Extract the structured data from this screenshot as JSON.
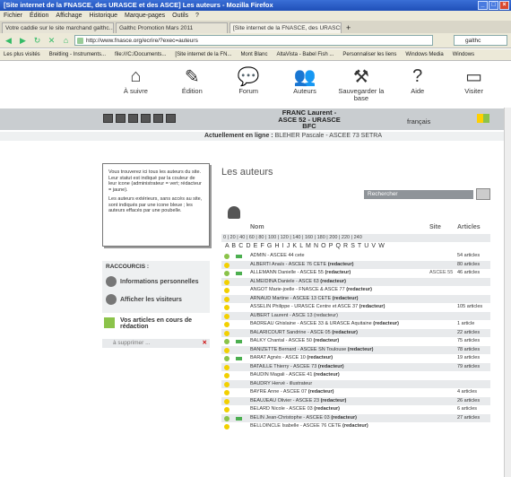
{
  "window": {
    "title": "[Site internet de la FNASCE, des URASCE et des ASCE] Les auteurs - Mozilla Firefox"
  },
  "menu": [
    "Fichier",
    "Édition",
    "Affichage",
    "Historique",
    "Marque-pages",
    "Outils",
    "?"
  ],
  "tabs": [
    {
      "label": "Votre caddie sur le site marchand galthc..."
    },
    {
      "label": "Galthc Promotion Mars 2011"
    },
    {
      "label": "[Site internet de la FNASCE, des URASCE..."
    }
  ],
  "nav": {
    "url": "http://www.fnasce.org/ecrire/?exec=auteurs",
    "search": "galthc"
  },
  "bookmarks": [
    "Les plus visités",
    "Breitling - Instruments...",
    "file:///C:/Documents...",
    "[Site internet de la FN...",
    "Mont Blanc",
    "AltaVista - Babel Fish ...",
    "Personnaliser les liens",
    "Windows Media",
    "Windows"
  ],
  "site_nav": [
    {
      "icon": "house-icon",
      "glyph": "⌂",
      "label": "À suivre"
    },
    {
      "icon": "pencil-icon",
      "glyph": "✎",
      "label": "Édition"
    },
    {
      "icon": "speech-bubble-icon",
      "glyph": "💬",
      "label": "Forum"
    },
    {
      "icon": "people-icon",
      "glyph": "👥",
      "label": "Auteurs"
    },
    {
      "icon": "tools-icon",
      "glyph": "⚒",
      "label": "Sauvegarder la base"
    },
    {
      "icon": "question-icon",
      "glyph": "?",
      "label": "Aide"
    },
    {
      "icon": "monitor-icon",
      "glyph": "▭",
      "label": "Visiter"
    }
  ],
  "banner": {
    "user": "FRANC Laurent - ASCE 52 - URASCE BFC",
    "language": "français"
  },
  "online": {
    "label": "Actuellement en ligne :",
    "names": "BLEHER Pascale - ASCEE 73 SETRA"
  },
  "info_box": {
    "p1": "Vous trouverez ici tous les auteurs du site. Leur statut est indiqué par la couleur de leur icone (administrateur = vert; rédacteur = jaune).",
    "p2": "Les auteurs extérieurs, sans accès au site, sont indiqués par une icone bleue ; les auteurs effacés par une poubelle."
  },
  "shortcuts": {
    "title": "RACCOURCIS :",
    "items": [
      "Informations personnelles",
      "Afficher les visiteurs"
    ]
  },
  "articles": {
    "title": "Vos articles en cours de rédaction",
    "item": "à supprimer ...",
    "delete_glyph": "✕"
  },
  "main": {
    "heading": "Les auteurs",
    "search_placeholder": "Rechercher",
    "columns": {
      "name": "Nom",
      "site": "Site",
      "articles": "Articles"
    },
    "pager": "0 | 20 | 40 | 60 | 80 | 100 | 120 | 140 | 160 | 180 | 200 | 220 | 240",
    "alphabet": "A B C D E F G H I J K L M N O P Q R S T U V W"
  },
  "authors": [
    {
      "role": "admin",
      "mail": true,
      "name": "ADMIN - ASCEE 44 cete",
      "tag": "",
      "site": "",
      "count": "54 articles"
    },
    {
      "role": "red",
      "mail": false,
      "name": "ALBERTI Anaïs - ASCEE 76 CETE",
      "tag": "(redacteur)",
      "site": "",
      "count": "80 articles"
    },
    {
      "role": "admin",
      "mail": true,
      "name": "ALLEMANN Danielle - ASCEE 55",
      "tag": "(redacteur)",
      "site": "ASCEE 55",
      "count": "46 articles"
    },
    {
      "role": "red",
      "mail": false,
      "name": "ALMEIDINA Daniele - ASCE 63",
      "tag": "(redacteur)",
      "site": "",
      "count": ""
    },
    {
      "role": "red",
      "mail": false,
      "name": "ANGOT Marie-joelle - FNASCE & ASCE 77",
      "tag": "(redacteur)",
      "site": "",
      "count": ""
    },
    {
      "role": "red",
      "mail": false,
      "name": "ARNAUD Martine - ASCEE 13 CETE",
      "tag": "(redacteur)",
      "site": "",
      "count": ""
    },
    {
      "role": "red",
      "mail": false,
      "name": "ASSELIN Philippe - URASCE Centre et ASCE 37",
      "tag": "(redacteur)",
      "site": "",
      "count": "105 articles"
    },
    {
      "role": "red",
      "mail": false,
      "name": "AUBERT Laurent - ASCE 13 (redacteur)",
      "tag": "",
      "site": "",
      "count": ""
    },
    {
      "role": "red",
      "mail": false,
      "name": "BADREAU Ghislaine - ASCEE 33 & URASCE Aquitaine",
      "tag": "(redacteur)",
      "site": "",
      "count": "1 article"
    },
    {
      "role": "red",
      "mail": false,
      "name": "BALARICOURT Sandrine - ASCE 05",
      "tag": "(redacteur)",
      "site": "",
      "count": "22 articles"
    },
    {
      "role": "admin",
      "mail": true,
      "name": "BALKY Chantal - ASCEE 50",
      "tag": "(redacteur)",
      "site": "",
      "count": "75 articles"
    },
    {
      "role": "red",
      "mail": false,
      "name": "BANIZETTE Bernard - ASCEE SN Toulouse",
      "tag": "(redacteur)",
      "site": "",
      "count": "78 articles"
    },
    {
      "role": "admin",
      "mail": true,
      "name": "BARAT Agnès - ASCE 10",
      "tag": "(redacteur)",
      "site": "",
      "count": "19 articles"
    },
    {
      "role": "red",
      "mail": false,
      "name": "BATAILLE Thierry - ASCEE 73",
      "tag": "(redacteur)",
      "site": "",
      "count": "79 articles"
    },
    {
      "role": "red",
      "mail": false,
      "name": "BAUDIN Magali - ASCEE 41",
      "tag": "(redacteur)",
      "site": "",
      "count": ""
    },
    {
      "role": "red",
      "mail": false,
      "name": "BAUDRY Hervé - illustrateur",
      "tag": "",
      "site": "",
      "count": ""
    },
    {
      "role": "red",
      "mail": false,
      "name": "BAYRE Anne - ASCEE 07",
      "tag": "(redacteur)",
      "site": "",
      "count": "4 articles"
    },
    {
      "role": "red",
      "mail": false,
      "name": "BEAUJEAU Olivier - ASCEE 23",
      "tag": "(redacteur)",
      "site": "",
      "count": "26 articles"
    },
    {
      "role": "red",
      "mail": false,
      "name": "BELARD Nicole - ASCEE 03",
      "tag": "(redacteur)",
      "site": "",
      "count": "6 articles"
    },
    {
      "role": "admin",
      "mail": true,
      "name": "BELIN Jean-Christophe - ASCEE 03",
      "tag": "(redacteur)",
      "site": "",
      "count": "27 articles"
    },
    {
      "role": "red",
      "mail": false,
      "name": "BELLOINCLE Isabelle - ASCEE 76 CETE",
      "tag": "(redacteur)",
      "site": "",
      "count": ""
    }
  ]
}
